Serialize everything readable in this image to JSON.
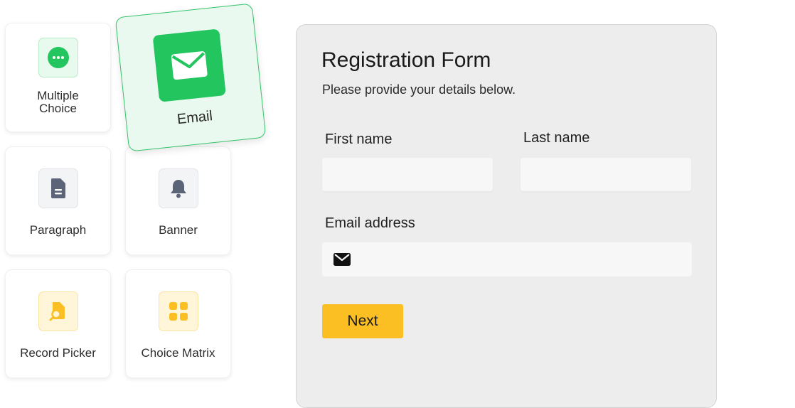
{
  "palette": {
    "items": [
      {
        "label": "Multiple Choice",
        "icon": "more-horizontal-icon"
      },
      {
        "label": "Paragraph",
        "icon": "document-icon"
      },
      {
        "label": "Banner",
        "icon": "bell-icon"
      },
      {
        "label": "Record Picker",
        "icon": "record-search-icon"
      },
      {
        "label": "Choice Matrix",
        "icon": "grid-icon"
      }
    ],
    "dragged_item": {
      "label": "Email",
      "icon": "envelope-icon"
    }
  },
  "form": {
    "title": "Registration Form",
    "subtitle": "Please provide your details below.",
    "first_name": {
      "label": "First name",
      "value": "",
      "placeholder": ""
    },
    "last_name": {
      "label": "Last name",
      "value": "",
      "placeholder": ""
    },
    "email": {
      "label": "Email address",
      "value": "",
      "placeholder": "",
      "icon": "envelope-icon"
    },
    "next_button": "Next"
  },
  "colors": {
    "accent_green": "#22c55e",
    "next_button_bg": "#fbbf24",
    "panel_bg": "#ededed"
  }
}
